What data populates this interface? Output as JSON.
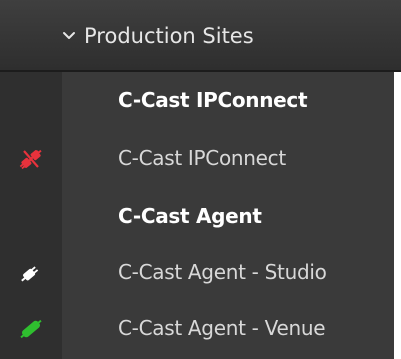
{
  "header": {
    "expand_icon": "chevron-down-icon",
    "title": "Production Sites"
  },
  "rows": [
    {
      "label": "C-Cast IPConnect",
      "type": "group",
      "icon": null
    },
    {
      "label": "C-Cast IPConnect",
      "type": "item",
      "icon": "disconnected-plug-icon",
      "icon_color": "#e8323c"
    },
    {
      "label": "C-Cast Agent",
      "type": "group",
      "icon": null
    },
    {
      "label": "C-Cast Agent - Studio",
      "type": "item",
      "icon": "plug-icon",
      "icon_color": "#ffffff"
    },
    {
      "label": "C-Cast Agent - Venue",
      "type": "item",
      "icon": "connected-plug-icon",
      "icon_color": "#2fbf2f"
    }
  ],
  "colors": {
    "header_bg": "#383838",
    "sidebar_bg": "#2f2f2f",
    "list_bg": "#3a3a3a",
    "status_error": "#e8323c",
    "status_ok": "#2fbf2f"
  }
}
